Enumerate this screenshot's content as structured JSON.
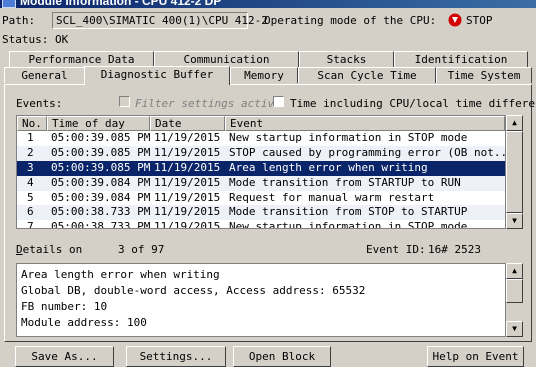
{
  "title": "Module Information - CPU 412-2 DP",
  "path_label": "Path:",
  "path_value": "SCL_400\\SIMATIC 400(1)\\CPU 412-2",
  "mode_label": "Operating mode of the  CPU:",
  "mode_value": "STOP",
  "status": "Status: OK",
  "tabs_row1": [
    "Performance Data",
    "Communication",
    "Stacks",
    "Identification"
  ],
  "tabs_row2": [
    "General",
    "Diagnostic Buffer",
    "Memory",
    "Scan Cycle Time",
    "Time System"
  ],
  "events_label": "Events:",
  "filter_label": "Filter settings activ",
  "time_cb_label": "Time including CPU/local time differenc",
  "columns": [
    "No.",
    "Time of day",
    "Date",
    "Event"
  ],
  "rows": [
    {
      "no": "1",
      "time": "05:00:39.085 PM",
      "date": "11/19/2015",
      "event": "New startup information in STOP mode"
    },
    {
      "no": "2",
      "time": "05:00:39.085 PM",
      "date": "11/19/2015",
      "event": "STOP caused by programming error (OB not..."
    },
    {
      "no": "3",
      "time": "05:00:39.085 PM",
      "date": "11/19/2015",
      "event": "Area length error when writing"
    },
    {
      "no": "4",
      "time": "05:00:39.084 PM",
      "date": "11/19/2015",
      "event": "Mode transition from STARTUP to RUN"
    },
    {
      "no": "5",
      "time": "05:00:39.084 PM",
      "date": "11/19/2015",
      "event": "Request for manual warm restart"
    },
    {
      "no": "6",
      "time": "05:00:38.733 PM",
      "date": "11/19/2015",
      "event": "Mode transition from STOP to STARTUP"
    },
    {
      "no": "7",
      "time": "05:00:38.733 PM",
      "date": "11/19/2015",
      "event": "New startup information in STOP mode"
    }
  ],
  "selected_row": 3,
  "details_label": "Details on",
  "details_count": "3 of 97",
  "event_id_label": "Event ID:",
  "event_id_value": "16# 2523",
  "details_lines": [
    "Area length error when writing",
    "Global DB, double-word access, Access address:  65532",
    "FB number:     10",
    "Module address:     100"
  ],
  "buttons": [
    "Save As...",
    "Settings...",
    "Open Block",
    "Help on Event"
  ],
  "colors": {
    "selection": "#0a246a",
    "stop_icon": "#d40000",
    "face": "#d4d0c8"
  }
}
